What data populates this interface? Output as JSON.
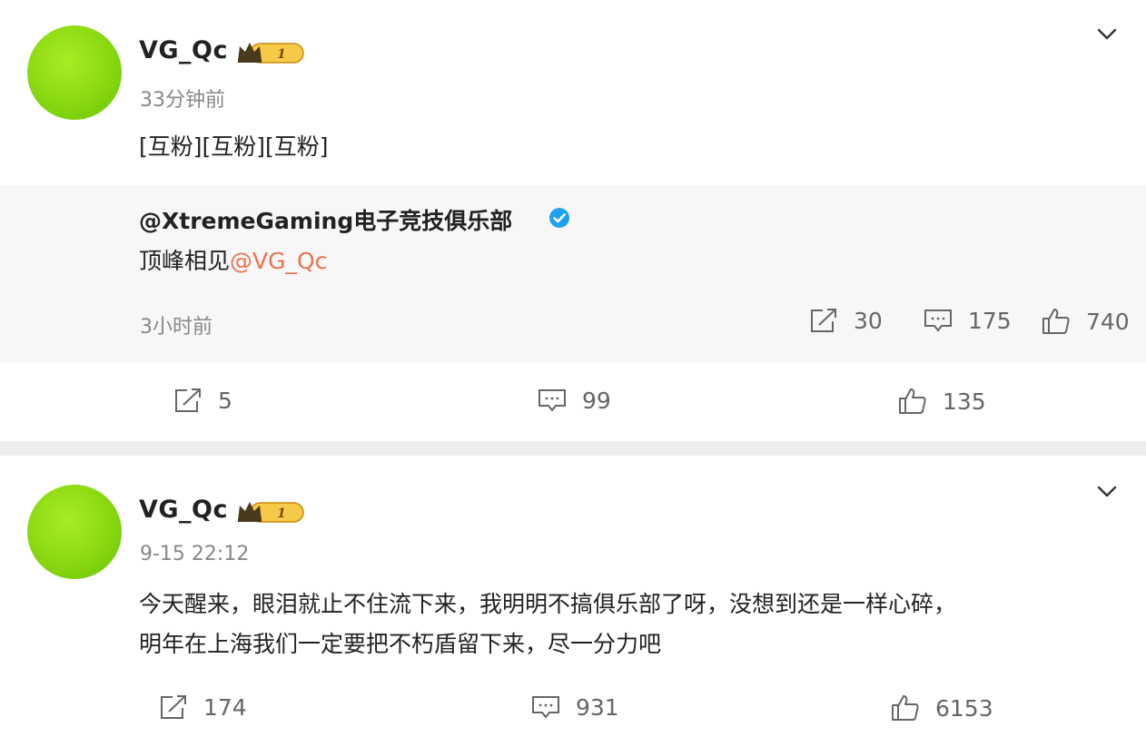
{
  "posts": [
    {
      "username": "VG_Qc",
      "vip_level": "1",
      "timestamp": "33分钟前",
      "text": "[互粉][互粉][互粉]",
      "repost": {
        "author": "@XtremeGaming电子竞技俱乐部",
        "text_prefix": "顶峰相见",
        "mention": "@VG_Qc",
        "time": "3小时前",
        "reposts": "30",
        "comments": "175",
        "likes": "740"
      },
      "reposts": "5",
      "comments": "99",
      "likes": "135"
    },
    {
      "username": "VG_Qc",
      "vip_level": "1",
      "timestamp": "9-15 22:12",
      "text_line1": "今天醒来，眼泪就止不住流下来，我明明不搞俱乐部了呀，没想到还是一样心碎，",
      "text_line2": "明年在上海我们一定要把不朽盾留下来，尽一分力吧",
      "reposts": "174",
      "comments": "931",
      "likes": "6153"
    }
  ],
  "colors": {
    "avatar": "#8fdc14",
    "mention": "#eb7350",
    "verified": "#1da1f2",
    "vip_gold": "#f5b91e"
  }
}
